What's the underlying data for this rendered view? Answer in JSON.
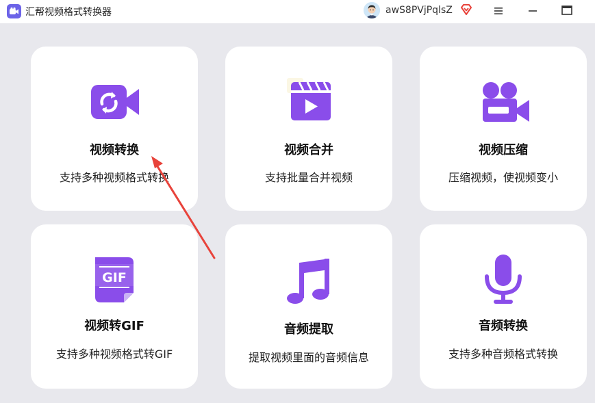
{
  "app": {
    "title": "汇帮视频格式转换器",
    "username": "awS8PVjPqlsZ"
  },
  "colors": {
    "accent": "#8a4dea",
    "arrow": "#e8433b",
    "vip": "#e8433b",
    "background": "#e8e8ed"
  },
  "window_controls": {
    "menu_icon": "hamburger-icon",
    "minimize_icon": "minimize-icon",
    "maximize_icon": "maximize-icon"
  },
  "cards": [
    {
      "id": "video-convert",
      "title": "视频转换",
      "desc": "支持多种视频格式转换",
      "icon": "video-convert-icon"
    },
    {
      "id": "video-merge",
      "title": "视频合并",
      "desc": "支持批量合并视频",
      "icon": "clapperboard-icon"
    },
    {
      "id": "video-compress",
      "title": "视频压缩",
      "desc": "压缩视频，使视频变小",
      "icon": "video-camera-icon"
    },
    {
      "id": "video-to-gif",
      "title": "视频转GIF",
      "desc": "支持多种视频格式转GIF",
      "icon": "gif-file-icon"
    },
    {
      "id": "audio-extract",
      "title": "音频提取",
      "desc": "提取视频里面的音频信息",
      "icon": "music-note-icon"
    },
    {
      "id": "audio-convert",
      "title": "音频转换",
      "desc": "支持多种音频格式转换",
      "icon": "microphone-icon"
    }
  ]
}
